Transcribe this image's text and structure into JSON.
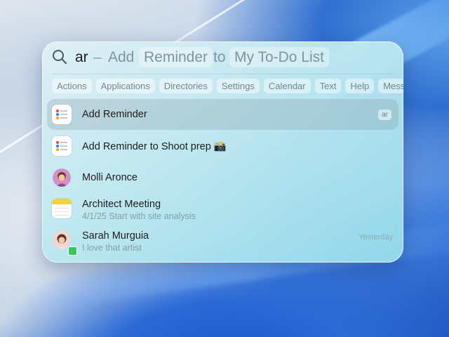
{
  "search": {
    "query": "ar",
    "dash": "–",
    "action_word": "Add",
    "action_token": "Reminder",
    "connector": "to",
    "target_token": "My To-Do List"
  },
  "filters": [
    "Actions",
    "Applications",
    "Directories",
    "Settings",
    "Calendar",
    "Text",
    "Help",
    "Messag"
  ],
  "results": [
    {
      "title": "Add Reminder",
      "badge": "ar",
      "icon": "reminders-icon",
      "selected": true
    },
    {
      "title": "Add Reminder to Shoot prep 📸",
      "icon": "reminders-icon"
    },
    {
      "title": "Molli Aronce",
      "icon": "contact-avatar-icon"
    },
    {
      "title": "Architect Meeting",
      "subtitle": "4/1/25 Start with site analysis",
      "icon": "notes-icon"
    },
    {
      "title": "Sarah Murguia",
      "subtitle": "I love that artist",
      "time": "Yesterday",
      "icon": "messages-avatar-icon"
    }
  ],
  "colors": {
    "accent_red": "#ff3b30",
    "accent_blue": "#0a84ff",
    "accent_orange": "#ff9f0a",
    "notes_yellow": "#f7cf3f",
    "messages_green": "#34c759"
  }
}
